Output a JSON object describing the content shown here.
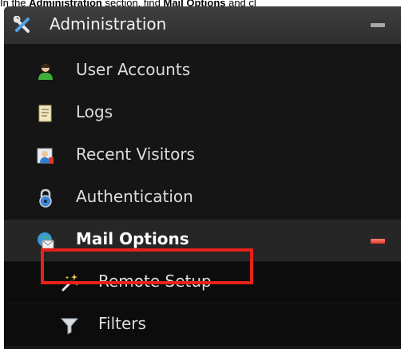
{
  "instruction": {
    "text_prefix": "In the ",
    "section_name": "Administration",
    "text_middle": " section, find ",
    "item_name": "Mail Options",
    "text_suffix": " and cl"
  },
  "menu": {
    "header": {
      "label": "Administration",
      "icon": "tools-icon"
    },
    "items": [
      {
        "label": "User Accounts",
        "icon": "user-icon"
      },
      {
        "label": "Logs",
        "icon": "document-icon"
      },
      {
        "label": "Recent Visitors",
        "icon": "visitor-card-icon"
      },
      {
        "label": "Authentication",
        "icon": "padlock-icon"
      },
      {
        "label": "Mail Options",
        "icon": "mail-globe-icon",
        "expanded": true
      },
      {
        "label": "Remote Setup",
        "icon": "magic-wand-icon",
        "highlighted": true
      },
      {
        "label": "Filters",
        "icon": "funnel-icon"
      }
    ]
  },
  "colors": {
    "panel_bg": "#151515",
    "highlight": "#e8211a",
    "collapse_active": "#e23a2a"
  }
}
